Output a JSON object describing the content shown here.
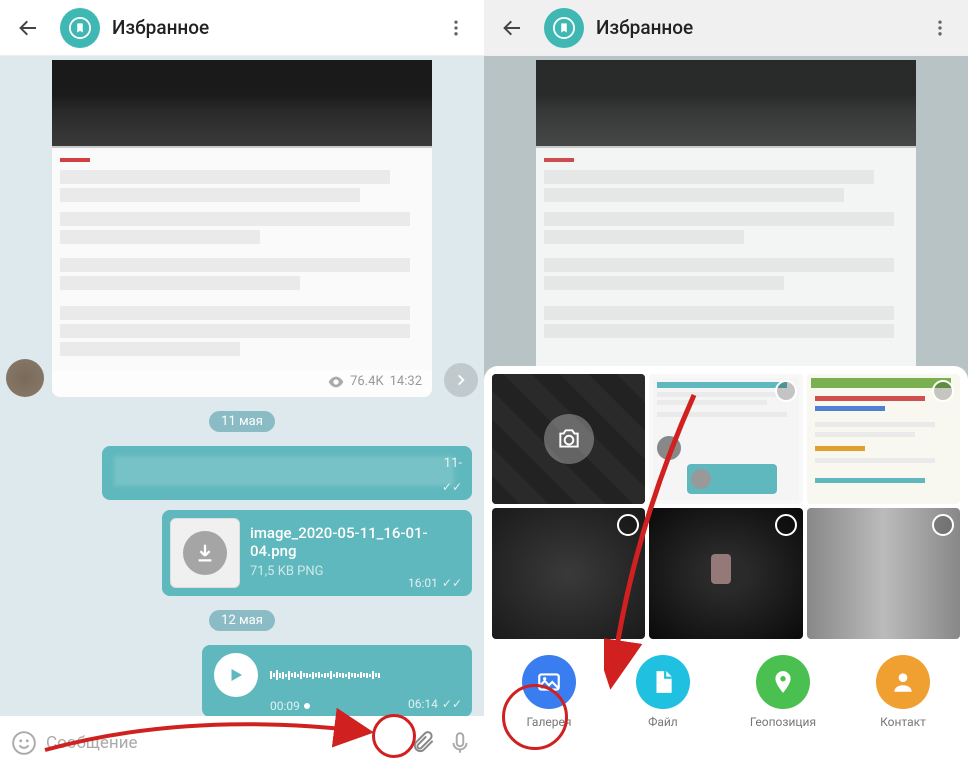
{
  "left": {
    "header": {
      "title": "Избранное"
    },
    "message_views": "76.4K",
    "message_time": "14:32",
    "date1": "11 мая",
    "bubble1_time": "11-",
    "file": {
      "name": "image_2020-05-11_16-01-04.png",
      "meta": "71,5 KB PNG",
      "time": "16:01"
    },
    "date2": "12 мая",
    "audio": {
      "elapsed": "00:09",
      "time": "06:14"
    },
    "input_placeholder": "Сообщение"
  },
  "right": {
    "header": {
      "title": "Избранное"
    },
    "tabs": {
      "gallery": "Галерея",
      "file": "Файл",
      "geo": "Геопозиция",
      "contact": "Контакт"
    }
  }
}
